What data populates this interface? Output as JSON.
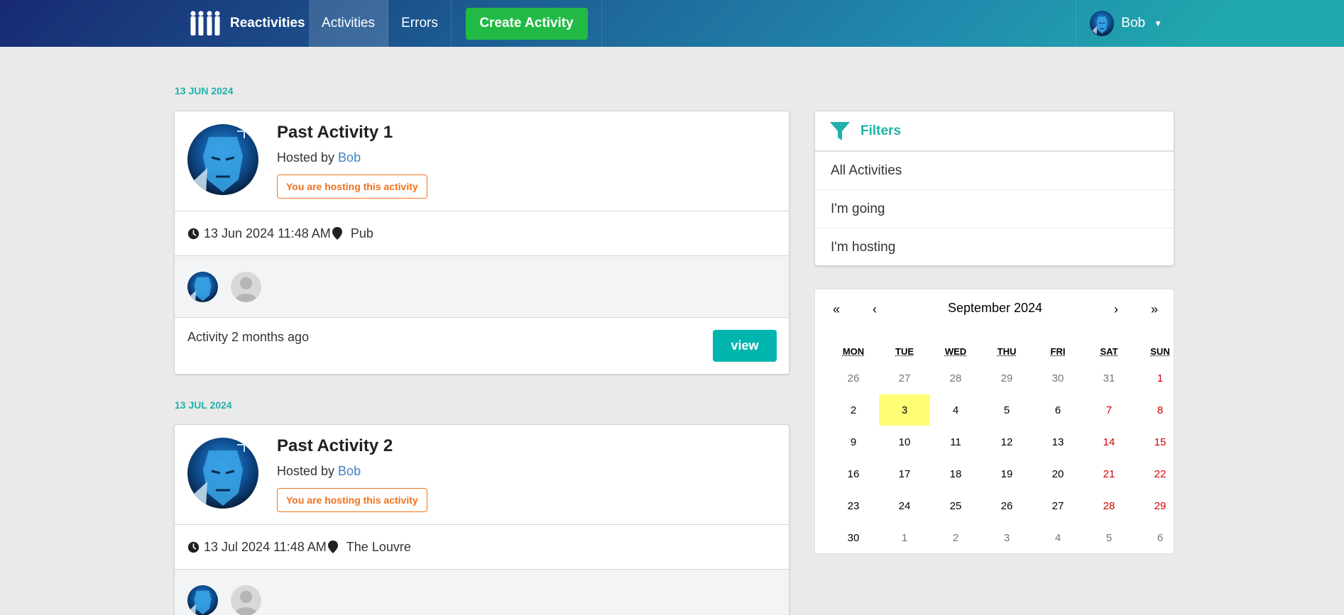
{
  "nav": {
    "brand": "Reactivities",
    "activities": "Activities",
    "errors": "Errors",
    "create": "Create Activity",
    "user": "Bob",
    "caret": "▼"
  },
  "groups": [
    {
      "date": "13 JUN 2024",
      "title": "Past Activity 1",
      "hosted_prefix": "Hosted by ",
      "host": "Bob",
      "hosting_label": "You are hosting this activity",
      "datetime": "13 Jun 2024 11:48 AM",
      "venue": "Pub",
      "description": "Activity 2 months ago",
      "view": "view"
    },
    {
      "date": "13 JUL 2024",
      "title": "Past Activity 2",
      "hosted_prefix": "Hosted by ",
      "host": "Bob",
      "hosting_label": "You are hosting this activity",
      "datetime": "13 Jul 2024 11:48 AM",
      "venue": "The Louvre"
    }
  ],
  "filters": {
    "title": "Filters",
    "items": [
      "All Activities",
      "I'm going",
      "I'm hosting"
    ]
  },
  "calendar": {
    "prev_year": "«",
    "prev_month": "‹",
    "label": "September 2024",
    "next_month": "›",
    "next_year": "»",
    "weekdays": [
      "MON",
      "TUE",
      "WED",
      "THU",
      "FRI",
      "SAT",
      "SUN"
    ],
    "weeks": [
      [
        "26",
        "27",
        "28",
        "29",
        "30",
        "31",
        "1"
      ],
      [
        "2",
        "3",
        "4",
        "5",
        "6",
        "7",
        "8"
      ],
      [
        "9",
        "10",
        "11",
        "12",
        "13",
        "14",
        "15"
      ],
      [
        "16",
        "17",
        "18",
        "19",
        "20",
        "21",
        "22"
      ],
      [
        "23",
        "24",
        "25",
        "26",
        "27",
        "28",
        "29"
      ],
      [
        "30",
        "1",
        "2",
        "3",
        "4",
        "5",
        "6"
      ]
    ],
    "today": "3",
    "colors": {
      "today": "#ffff76",
      "weekend": "#d10000",
      "other_month": "#757575"
    }
  },
  "colors": {
    "accent": "#20b2aa",
    "create": "#21ba45",
    "view": "#00b5ad",
    "hosting": "#f2711c",
    "link": "#4183c4"
  }
}
